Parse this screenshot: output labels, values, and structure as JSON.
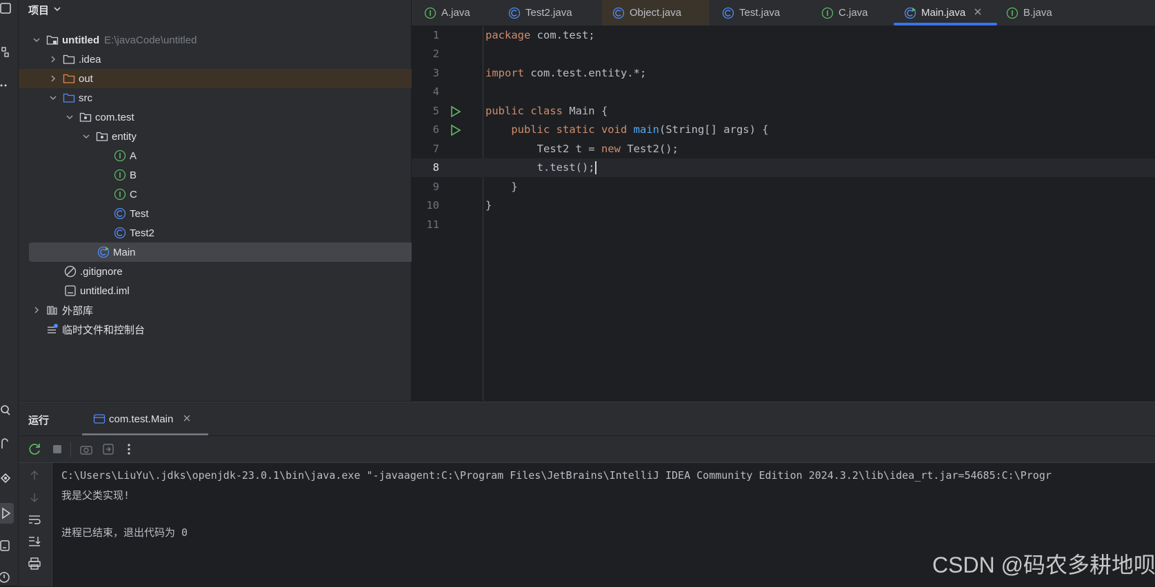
{
  "project": {
    "title": "项目",
    "root_name": "untitled",
    "root_path": "E:\\javaCode\\untitled",
    "items": [
      {
        "label": ".idea"
      },
      {
        "label": "out"
      },
      {
        "label": "src"
      },
      {
        "label": "com.test"
      },
      {
        "label": "entity"
      },
      {
        "label": "A"
      },
      {
        "label": "B"
      },
      {
        "label": "C"
      },
      {
        "label": "Test"
      },
      {
        "label": "Test2"
      },
      {
        "label": "Main"
      },
      {
        "label": ".gitignore"
      },
      {
        "label": "untitled.iml"
      },
      {
        "label": "外部库"
      },
      {
        "label": "临时文件和控制台"
      }
    ]
  },
  "tabs": [
    {
      "label": "A.java"
    },
    {
      "label": "Test2.java"
    },
    {
      "label": "Object.java"
    },
    {
      "label": "Test.java"
    },
    {
      "label": "C.java"
    },
    {
      "label": "Main.java"
    },
    {
      "label": "B.java"
    }
  ],
  "editor": {
    "line_numbers": [
      "1",
      "2",
      "3",
      "4",
      "5",
      "6",
      "7",
      "8",
      "9",
      "10",
      "11"
    ],
    "l1": {
      "kw": "package",
      "rest": " com.test;"
    },
    "l3": {
      "kw": "import",
      "rest": " com.test.entity.*;"
    },
    "l5": {
      "kw": "public class",
      "rest": " Main {"
    },
    "l6": {
      "indent": "    ",
      "kw": "public static void",
      "fn": "main",
      "rest": "(String[] args) {"
    },
    "l7": {
      "pre": "        Test2 t = ",
      "kw": "new",
      "rest": " Test2();"
    },
    "l8": {
      "text": "        t.test();"
    },
    "l9": {
      "text": "    }"
    },
    "l10": {
      "text": "}"
    }
  },
  "run": {
    "title": "运行",
    "tab_label": "com.test.Main",
    "console": [
      "C:\\Users\\LiuYu\\.jdks\\openjdk-23.0.1\\bin\\java.exe \"-javaagent:C:\\Program Files\\JetBrains\\IntelliJ IDEA Community Edition 2024.3.2\\lib\\idea_rt.jar=54685:C:\\Progr",
      "我是父类实现!",
      "",
      "进程已结束，退出代码为 0"
    ]
  },
  "watermark": "CSDN @码农多耕地呗",
  "colors": {
    "accent": "#3574f0",
    "keyword": "#cf8e6d",
    "function": "#56a8f5",
    "run_green": "#5fb865",
    "interface_green": "#5fb865",
    "class_blue": "#548af7"
  },
  "icons": {
    "interface": "interface-icon",
    "class": "class-icon",
    "folder": "folder-icon",
    "package": "package-icon",
    "run": "run-gutter-icon"
  }
}
